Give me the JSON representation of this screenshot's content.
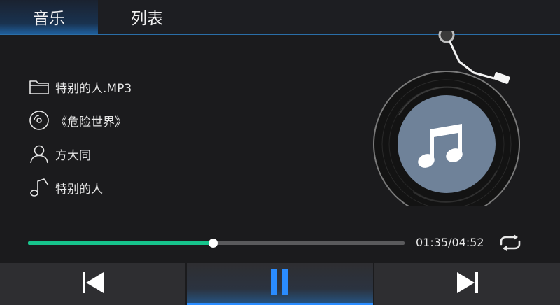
{
  "tabs": {
    "music": "音乐",
    "list": "列表"
  },
  "track": {
    "filename": "特别的人.MP3",
    "album": "《危险世界》",
    "artist": "方大同",
    "title": "特别的人"
  },
  "icons": {
    "file": "folder-icon",
    "album": "disc-icon",
    "artist": "person-icon",
    "title": "music-note-icon",
    "repeat": "repeat-icon",
    "prev": "previous-icon",
    "pause": "pause-icon",
    "next": "next-icon"
  },
  "playback": {
    "time": "01:35/04:52",
    "progress": 0.49
  },
  "colors": {
    "accent": "#17c48c",
    "highlight": "#2a8cff",
    "disc_label": "#6f8299"
  }
}
